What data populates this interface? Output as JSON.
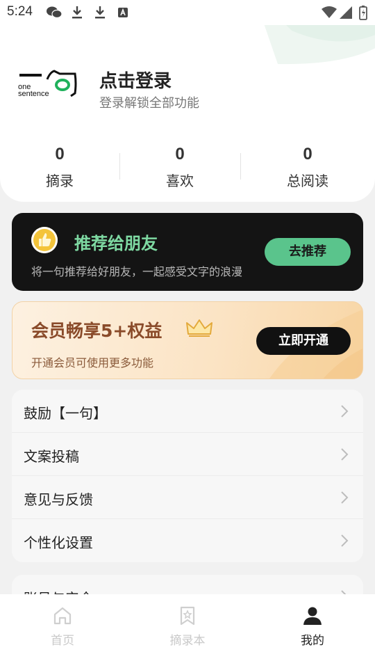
{
  "status_bar": {
    "time": "5:24",
    "left_icons": [
      "wechat-icon",
      "download-icon",
      "download-icon",
      "notification-a-icon"
    ],
    "right_icons": [
      "wifi-icon",
      "signal-icon",
      "battery-icon"
    ]
  },
  "profile": {
    "logo_text_top": "one",
    "logo_text_bottom": "sentence",
    "login_title": "点击登录",
    "login_subtitle": "登录解锁全部功能"
  },
  "stats": [
    {
      "value": "0",
      "label": "摘录"
    },
    {
      "value": "0",
      "label": "喜欢"
    },
    {
      "value": "0",
      "label": "总阅读"
    }
  ],
  "recommend": {
    "title": "推荐给朋友",
    "description": "将一句推荐给好朋友，一起感受文字的浪漫",
    "button": "去推荐",
    "accent": "#7ed9a2",
    "button_color": "#5ac48c"
  },
  "vip": {
    "title": "会员畅享5+权益",
    "description": "开通会员可使用更多功能",
    "button": "立即开通"
  },
  "menu": [
    {
      "label": "鼓励【一句】"
    },
    {
      "label": "文案投稿"
    },
    {
      "label": "意见与反馈"
    },
    {
      "label": "个性化设置"
    }
  ],
  "menu_partial": {
    "label": "账号与安全"
  },
  "bottom_nav": [
    {
      "label": "首页",
      "icon": "home-icon",
      "active": false
    },
    {
      "label": "摘录本",
      "icon": "bookmark-star-icon",
      "active": false
    },
    {
      "label": "我的",
      "icon": "person-icon",
      "active": true
    }
  ]
}
